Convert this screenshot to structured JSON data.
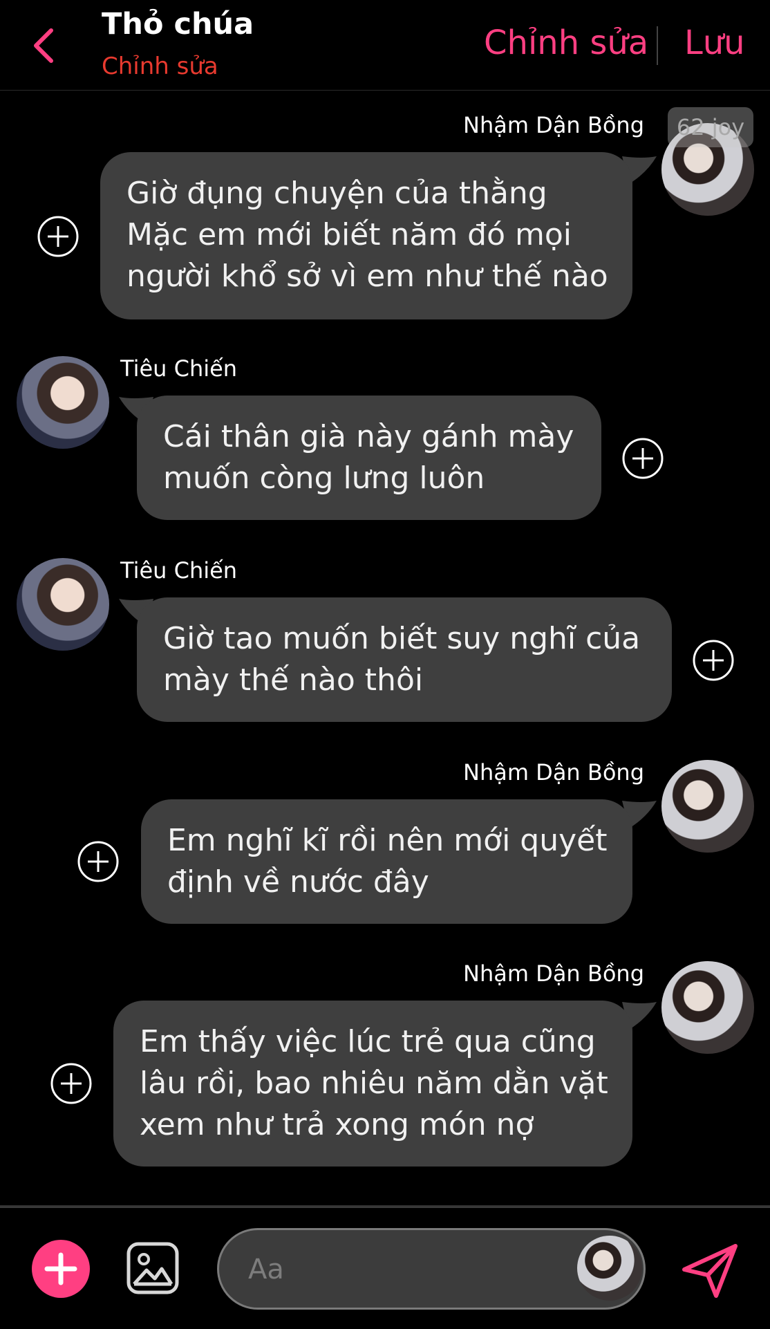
{
  "header": {
    "title": "Thỏ chúa",
    "subtitle": "Chỉnh sửa",
    "edit_label": "Chỉnh sửa",
    "save_label": "Lưu"
  },
  "badge": "62 joy",
  "messages": [
    {
      "sender": "Nhậm Dận Bồng",
      "side": "right",
      "lines": [
        "Giờ đụng chuyện của thằng",
        "Mặc em mới biết năm đó mọi",
        "người khổ sở vì em như thế nào"
      ]
    },
    {
      "sender": "Tiêu Chiến",
      "side": "left",
      "lines": [
        "Cái thân già này gánh mày",
        "muốn còng lưng luôn"
      ]
    },
    {
      "sender": "Tiêu Chiến",
      "side": "left",
      "lines": [
        "Giờ tao muốn biết suy nghĩ của",
        "mày thế nào thôi"
      ]
    },
    {
      "sender": "Nhậm Dận Bồng",
      "side": "right",
      "lines": [
        "Em nghĩ kĩ rồi nên mới quyết",
        "định về nước đây"
      ]
    },
    {
      "sender": "Nhậm Dận Bồng",
      "side": "right",
      "lines": [
        "Em thấy việc lúc trẻ qua cũng",
        "lâu rồi, bao nhiêu năm dằn vặt",
        "xem như trả xong món nợ"
      ]
    }
  ],
  "composer": {
    "placeholder": "Aa"
  },
  "colors": {
    "accent": "#ff3f82",
    "subtitle": "#e83a2f",
    "bubble": "#3f3f3f",
    "background": "#000000"
  },
  "icons": [
    "back-chevron-icon",
    "plus-circle-icon",
    "image-gallery-icon",
    "add-icon",
    "send-icon"
  ]
}
